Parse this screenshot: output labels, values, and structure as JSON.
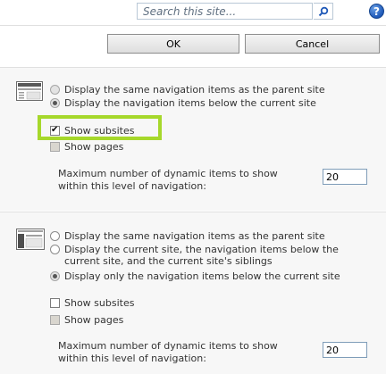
{
  "search": {
    "placeholder": "Search this site..."
  },
  "help": {
    "label": "?"
  },
  "buttons": {
    "ok": "OK",
    "cancel": "Cancel"
  },
  "global_nav": {
    "option_parent": "Display the same navigation items as the parent site",
    "option_below": "Display the navigation items below the current site",
    "selected": "option_below",
    "show_subsites": {
      "label": "Show subsites",
      "checked": true
    },
    "show_pages": {
      "label": "Show pages",
      "checked": false,
      "disabled": true
    },
    "max_items_label": "Maximum number of dynamic items to show within this level of navigation:",
    "max_items_value": "20"
  },
  "current_nav": {
    "option_parent": "Display the same navigation items as the parent site",
    "option_siblings": "Display the current site, the navigation items below the current site, and the current site's siblings",
    "option_below": "Display only the navigation items below the current site",
    "selected": "option_below",
    "show_subsites": {
      "label": "Show subsites",
      "checked": false
    },
    "show_pages": {
      "label": "Show pages",
      "checked": false,
      "disabled": true
    },
    "max_items_label": "Maximum number of dynamic items to show within this level of navigation:",
    "max_items_value": "20"
  },
  "colors": {
    "highlight": "#a6d82b",
    "section_bg": "#f7f7f7",
    "help": "#1f59b8"
  },
  "icons": {
    "search": "magnifier-icon",
    "help": "help-icon",
    "global_nav": "top-navigation-layout-icon",
    "current_nav": "side-navigation-layout-icon"
  }
}
